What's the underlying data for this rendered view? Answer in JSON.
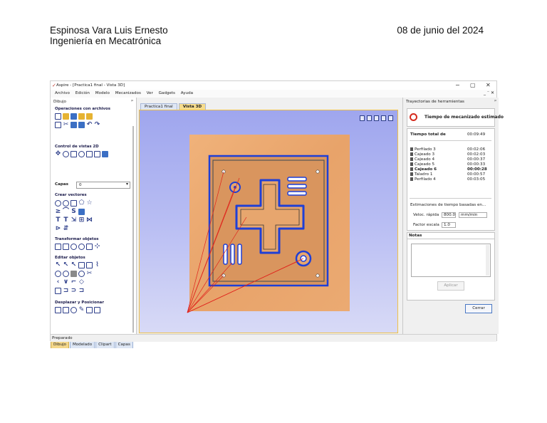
{
  "header": {
    "author": "Espinosa Vara Luis Ernesto",
    "career": "Ingeniería en Mecatrónica",
    "date": "08 de junio del 2024"
  },
  "app": {
    "title": "Aspire - [Practica1 final - Vista 3D]",
    "window_controls": [
      "−",
      "▢",
      "✕"
    ],
    "menu": [
      "Archivo",
      "Edición",
      "Modelo",
      "Mecanizados",
      "Ver",
      "Gadgets",
      "Ayuda"
    ],
    "menu_right": "_ ⁻ ✕"
  },
  "left_panel": {
    "title": "Dibujo",
    "sections": {
      "archivos": "Operaciones con archivos",
      "control2d": "Control de vistas 2D",
      "crear": "Crear vectores",
      "transformar": "Transformar objetos",
      "editar": "Editar objetos",
      "desplazar": "Desplazar y Posicionar"
    },
    "capas_label": "Capas",
    "capas_value": "0",
    "tabs": [
      "Dibujo",
      "Modelado",
      "Clipart",
      "Capas"
    ]
  },
  "view_tabs": [
    "Practica1 final",
    "Vista 3D"
  ],
  "right_panel": {
    "title": "Trayectorias de herramientas",
    "estimate_title": "Tiempo de mecanizado estimado",
    "total_label": "Tiempo total de",
    "total_value": "00:09:49",
    "operations": [
      {
        "name": "Perfilado 3",
        "time": "00:02:06",
        "bold": false
      },
      {
        "name": "Cajeado 3",
        "time": "00:02:03",
        "bold": false
      },
      {
        "name": "Cajeado 4",
        "time": "00:00:37",
        "bold": false
      },
      {
        "name": "Cajeado 5",
        "time": "00:00:33",
        "bold": false
      },
      {
        "name": "Cajeado 6",
        "time": "00:00:28",
        "bold": true
      },
      {
        "name": "Taladro 1",
        "time": "00:00:57",
        "bold": false
      },
      {
        "name": "Perfilado 4",
        "time": "00:03:05",
        "bold": false
      }
    ],
    "estimates_label": "Estimaciones de tiempo basadas en...",
    "rapid_label": "Veloc. rápida",
    "rapid_value": "800.0",
    "rapid_unit": "mm/min",
    "scale_label": "Factor escala",
    "scale_value": "1.0",
    "notes_label": "Notas",
    "apply_label": "Aplicar",
    "close_label": "Cerrar"
  },
  "status": "Preparado",
  "colors": {
    "wood": "#e9a66c",
    "toolpath_blue": "#1f3fd6",
    "rapid_red": "#e0231c",
    "viewport_bg": "#aab0f0",
    "accent_tab": "#f6dc8c"
  }
}
